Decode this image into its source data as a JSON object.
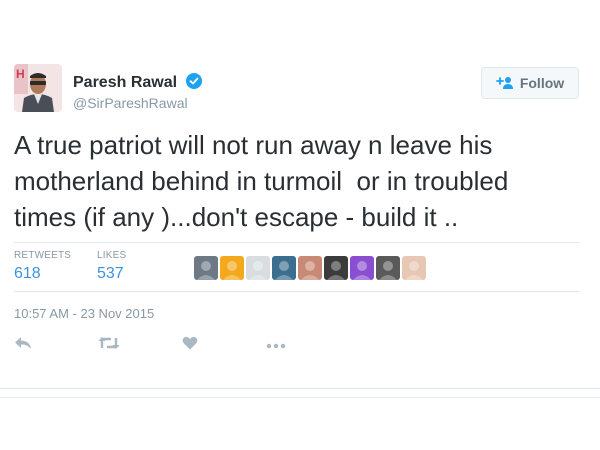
{
  "author": {
    "name": "Paresh Rawal",
    "handle": "@SirPareshRawal",
    "verified": true,
    "avatar_icon": "profile-photo"
  },
  "follow_button": {
    "label": "Follow",
    "icon": "add-user-icon"
  },
  "tweet": {
    "lines": [
      "A true patriot will not run away n leave his",
      "motherland behind in turmoil  or in troubled",
      "times (if any )...don't escape - build it .."
    ]
  },
  "stats": {
    "retweets_label": "RETWEETS",
    "retweets_value": "618",
    "likes_label": "LIKES",
    "likes_value": "537"
  },
  "likers": [
    {
      "icon": "liker-avatar",
      "color": "#6d7a86"
    },
    {
      "icon": "liker-avatar",
      "color": "#f4a91c"
    },
    {
      "icon": "liker-avatar",
      "color": "#d9dde0"
    },
    {
      "icon": "liker-avatar",
      "color": "#3c6e8f"
    },
    {
      "icon": "liker-avatar",
      "color": "#c98a75"
    },
    {
      "icon": "liker-avatar",
      "color": "#3b3b3b"
    },
    {
      "icon": "liker-avatar",
      "color": "#8a4fd0"
    },
    {
      "icon": "liker-avatar",
      "color": "#5a5a5a"
    },
    {
      "icon": "liker-avatar",
      "color": "#e8c7b4"
    }
  ],
  "timestamp": "10:57 AM - 23 Nov 2015",
  "actions": [
    {
      "name": "reply-icon"
    },
    {
      "name": "retweet-icon"
    },
    {
      "name": "like-icon"
    },
    {
      "name": "more-icon"
    }
  ],
  "colors": {
    "text": "#292f33",
    "muted": "#8899a6",
    "link": "#3b94d9",
    "verified": "#1da1f2",
    "border": "#e1e8ed",
    "action_icon": "#aab8c2"
  }
}
